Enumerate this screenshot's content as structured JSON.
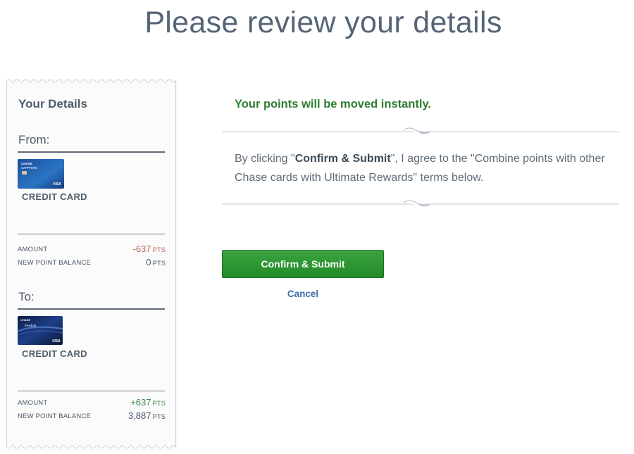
{
  "page": {
    "title": "Please review your details"
  },
  "details": {
    "heading": "Your Details",
    "from": {
      "label": "From:",
      "card_type": "CREDIT CARD",
      "card_image": "chase-sapphire-card",
      "amount_label": "AMOUNT",
      "amount_value": "-637",
      "amount_unit": "PTS",
      "balance_label": "NEW POINT BALANCE",
      "balance_value": "0",
      "balance_unit": "PTS"
    },
    "to": {
      "label": "To:",
      "card_type": "CREDIT CARD",
      "card_image": "chase-freedom-unlimited-card",
      "amount_label": "AMOUNT",
      "amount_value": "+637",
      "amount_unit": "PTS",
      "balance_label": "NEW POINT BALANCE",
      "balance_value": "3,887",
      "balance_unit": "PTS"
    }
  },
  "main": {
    "info_message": "Your points will be moved instantly.",
    "terms_prefix": "By clicking \"",
    "terms_bold": "Confirm & Submit",
    "terms_suffix": "\", I agree to the \"Combine points with other Chase cards with Ultimate Rewards\" terms below.",
    "confirm_label": "Confirm & Submit",
    "cancel_label": "Cancel"
  },
  "colors": {
    "primary_button": "#2e9633",
    "info_text": "#2e7d32",
    "negative": "#b36a5e",
    "positive": "#3e8a45",
    "link": "#3b6ea8"
  }
}
